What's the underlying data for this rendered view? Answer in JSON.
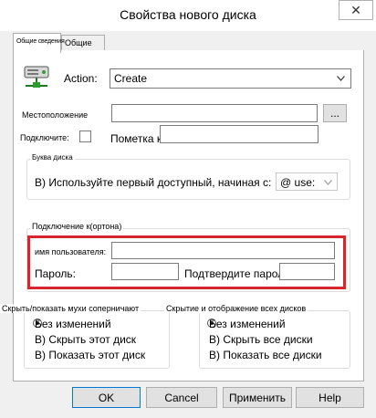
{
  "window": {
    "title": "Свойства нового диска",
    "close_glyph": "✕"
  },
  "tabs": [
    {
      "label": "Общие сведения"
    },
    {
      "label": "Общие"
    }
  ],
  "action": {
    "label": "Action:",
    "value": "Create",
    "icon": "network-drive-icon"
  },
  "location": {
    "label": "Местоположение",
    "value": "",
    "browse_label": "..."
  },
  "reconnect": {
    "label": "Подключите:",
    "checked": false
  },
  "drive_label": {
    "label": "Пометка как:",
    "value": ""
  },
  "drive_letter": {
    "group_title": "Буква диска",
    "mode_label": "В) Используйте первый доступный, начиная с:",
    "value": "@ use:"
  },
  "connect_as": {
    "group_title": "Подключение к(ортона)",
    "username_label": "имя пользователя:",
    "username_value": "",
    "password_label": "Пароль:",
    "password_value": "",
    "confirm_label": "Подтвердите пароль:",
    "confirm_value": ""
  },
  "hide_show_this": {
    "group_title": "Скрыть/показать мухи соперничают",
    "options": [
      "Без изменений",
      "В) Скрыть этот диск",
      "В) Показать этот диск"
    ],
    "selected": 0
  },
  "hide_show_all": {
    "group_title": "Скрытие и отображение всех дисков",
    "options": [
      "Без изменений",
      "В) Скрыть все диски",
      "В) Показать все диски"
    ],
    "selected": 0
  },
  "buttons": {
    "ok": "OK",
    "cancel": "Cancel",
    "apply": "Применить",
    "help": "Help"
  },
  "colors": {
    "highlight": "#d9262e",
    "focus": "#0078d7"
  }
}
